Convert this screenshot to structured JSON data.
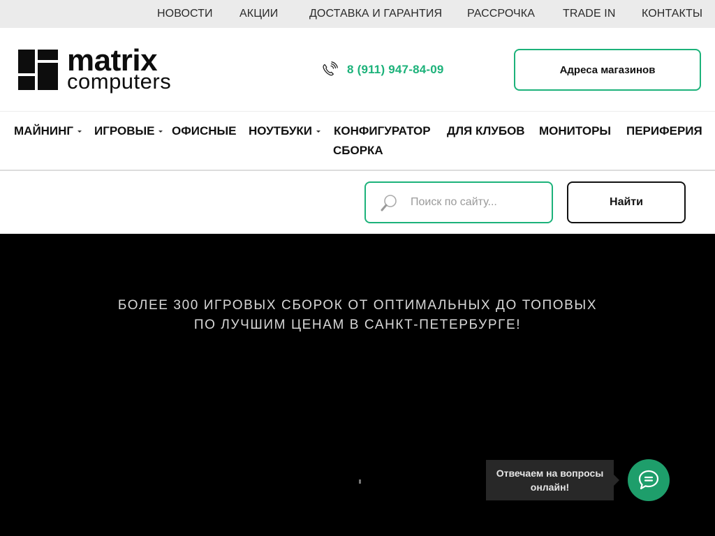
{
  "topbar": {
    "links": [
      {
        "label": "НОВОСТИ"
      },
      {
        "label": "АКЦИИ"
      },
      {
        "label": "ДОСТАВКА И ГАРАНТИЯ"
      },
      {
        "label": "РАССРОЧКА"
      },
      {
        "label": "TRADE IN"
      },
      {
        "label": "КОНТАКТЫ"
      }
    ]
  },
  "header": {
    "logo": {
      "line1": "matrix",
      "line2": "computers"
    },
    "phone": {
      "icon": "phone-icon",
      "number": "8 (911) 947-84-09"
    },
    "stores_button": "Адреса магазинов"
  },
  "nav": {
    "items": [
      {
        "label": "МАЙНИНГ",
        "has_dropdown": true
      },
      {
        "label": "ИГРОВЫЕ",
        "has_dropdown": true
      },
      {
        "label": "ОФИСНЫЕ",
        "has_dropdown": false
      },
      {
        "label": "НОУТБУКИ",
        "has_dropdown": true
      },
      {
        "label": "КОНФИГУРАТОР",
        "has_dropdown": false
      },
      {
        "label": "ДЛЯ КЛУБОВ",
        "has_dropdown": false
      },
      {
        "label": "МОНИТОРЫ",
        "has_dropdown": false
      },
      {
        "label": "ПЕРИФЕРИЯ",
        "has_dropdown": false
      },
      {
        "label": "СБОРКА",
        "has_dropdown": false
      }
    ]
  },
  "search": {
    "icon": "search-icon",
    "placeholder": "Поиск по сайту...",
    "value": "",
    "button": "Найти"
  },
  "hero": {
    "line1": "БОЛЕЕ 300 ИГРОВЫХ СБОРОК ОТ ОПТИМАЛЬНЫХ ДО ТОПОВЫХ",
    "line2": "ПО ЛУЧШИМ ЦЕНАМ В САНКТ-ПЕТЕРБУРГЕ!"
  },
  "chat": {
    "tooltip": "Отвечаем на вопросы онлайн!",
    "icon": "chat-bubble-icon"
  },
  "colors": {
    "accent": "#1cb27a",
    "chat_button": "#1e9e6b",
    "topbar_bg": "#ebebeb",
    "hero_bg": "#000000",
    "tooltip_bg": "#282828"
  }
}
